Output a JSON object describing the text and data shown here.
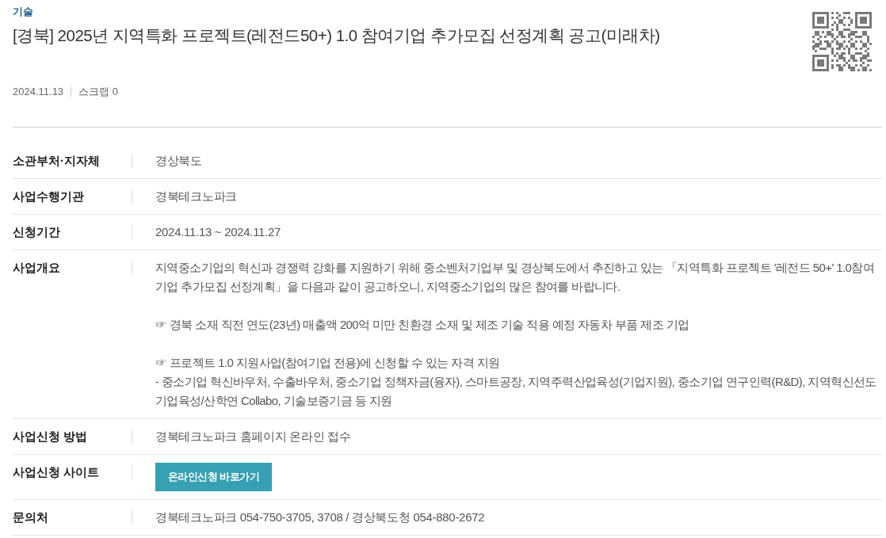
{
  "category": "기술",
  "title": "[경북] 2025년 지역특화 프로젝트(레전드50+) 1.0 참여기업 추가모집 선정계획 공고(미래차)",
  "meta": {
    "date": "2024.11.13",
    "scrap": "스크랩 0"
  },
  "details": [
    {
      "label": "소관부처·지자체",
      "kind": "text",
      "value": "경상북도"
    },
    {
      "label": "사업수행기관",
      "kind": "text",
      "value": "경북테크노파크"
    },
    {
      "label": "신청기간",
      "kind": "text",
      "value": "2024.11.13 ~ 2024.11.27"
    },
    {
      "label": "사업개요",
      "kind": "blocks",
      "blocks": [
        [
          "지역중소기업의 혁신과 경쟁력 강화를 지원하기 위해 중소벤처기업부 및 경상북도에서 추진하고 있는 「지역특화 프로젝트 '레전드 50+' 1.0참여기업 추가모집 선정계획」을 다음과 같이 공고하오니, 지역중소기업의 많은 참여를 바랍니다."
        ],
        [
          "☞ 경북 소재 직전 연도(23년) 매출액 200억 미만 친환경 소재 및 제조 기술 적용 예정 자동차 부품 제조 기업"
        ],
        [
          "☞ 프로젝트 1.0 지원사업(참여기업 전용)에 신청할 수 있는 자격 지원",
          "- 중소기업 혁신바우처, 수출바우처, 중소기업 정책자금(융자), 스마트공장, 지역주력산업육성(기업지원), 중소기업 연구인력(R&D), 지역혁신선도기업육성/산학연 Collabo, 기술보증기금 등 지원"
        ]
      ]
    },
    {
      "label": "사업신청 방법",
      "kind": "text",
      "value": "경북테크노파크 홈페이지 온라인 접수"
    },
    {
      "label": "사업신청 사이트",
      "kind": "button",
      "value": "온라인신청 바로가기"
    },
    {
      "label": "문의처",
      "kind": "text",
      "value": "경북테크노파크 054-750-3705, 3708 / 경상북도청 054-880-2672"
    }
  ]
}
